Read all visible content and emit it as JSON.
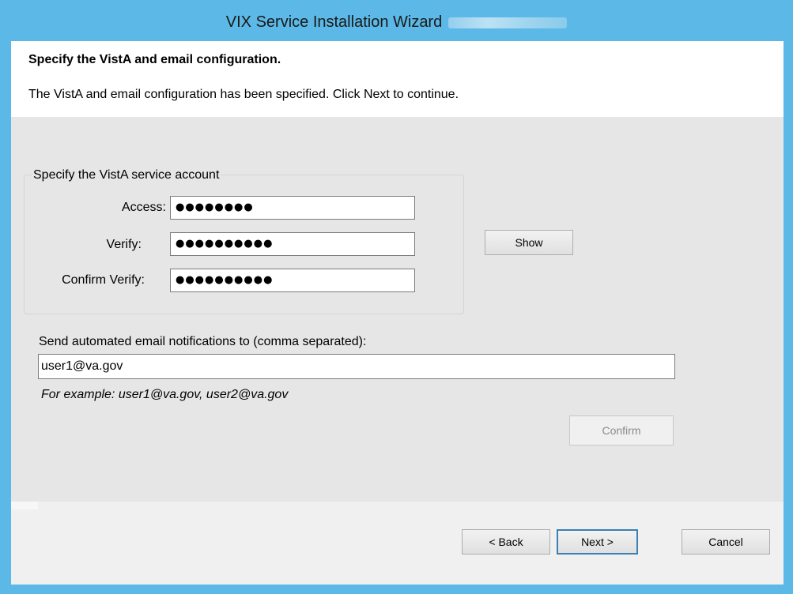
{
  "window": {
    "title": "VIX Service Installation Wizard"
  },
  "header": {
    "title": "Specify the VistA and email configuration.",
    "description": "The VistA and email configuration has been specified. Click Next to continue."
  },
  "account_group": {
    "label": "Specify the VistA service account",
    "access_label": "Access:",
    "access_value": "●●●●●●●●",
    "verify_label": "Verify:",
    "verify_value": "●●●●●●●●●●",
    "confirm_label": "Confirm Verify:",
    "confirm_value": "●●●●●●●●●●",
    "show_button": "Show"
  },
  "email": {
    "label": "Send automated email notifications to (comma separated):",
    "value": "user1@va.gov",
    "example": "For example: user1@va.gov, user2@va.gov",
    "confirm_button": "Confirm"
  },
  "footer": {
    "back_button": "< Back",
    "next_button": "Next >",
    "cancel_button": "Cancel"
  }
}
